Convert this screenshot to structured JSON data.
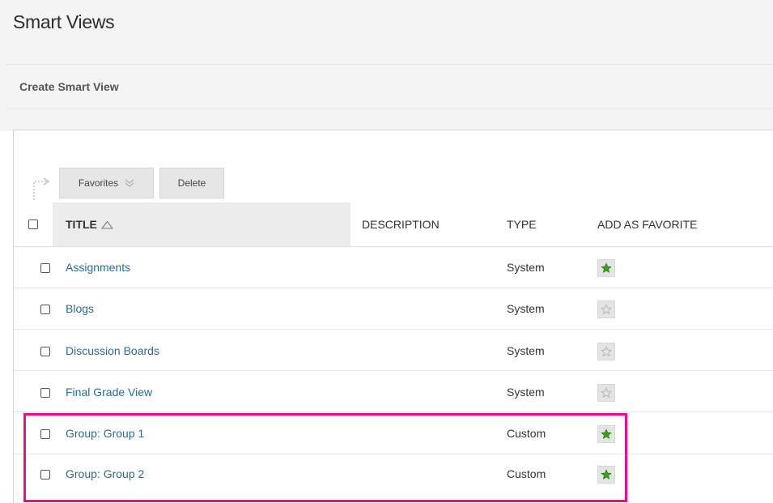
{
  "page": {
    "title": "Smart Views"
  },
  "action_bar": {
    "create_label": "Create Smart View"
  },
  "toolbar": {
    "favorites_label": "Favorites",
    "delete_label": "Delete"
  },
  "table": {
    "headers": {
      "title": "TITLE",
      "description": "DESCRIPTION",
      "type": "TYPE",
      "favorite": "ADD AS FAVORITE"
    },
    "rows": [
      {
        "title": "Assignments",
        "description": "",
        "type": "System",
        "favorite": true
      },
      {
        "title": "Blogs",
        "description": "",
        "type": "System",
        "favorite": false
      },
      {
        "title": "Discussion Boards",
        "description": "",
        "type": "System",
        "favorite": false
      },
      {
        "title": "Final Grade View",
        "description": "",
        "type": "System",
        "favorite": false
      },
      {
        "title": "Group: Group 1",
        "description": "",
        "type": "Custom",
        "favorite": true
      },
      {
        "title": "Group: Group 2",
        "description": "",
        "type": "Custom",
        "favorite": true
      }
    ]
  },
  "icons": {
    "bulk_arrow": "bulk-action-arrow-icon",
    "chevron": "double-chevron-down-icon",
    "sort": "sort-ascending-triangle-icon",
    "star": "star-icon"
  },
  "colors": {
    "link": "#2a6b93",
    "favorite_on": "#3ca11a",
    "favorite_off": "#b5b5b5",
    "highlight": "#ec0c8c"
  }
}
